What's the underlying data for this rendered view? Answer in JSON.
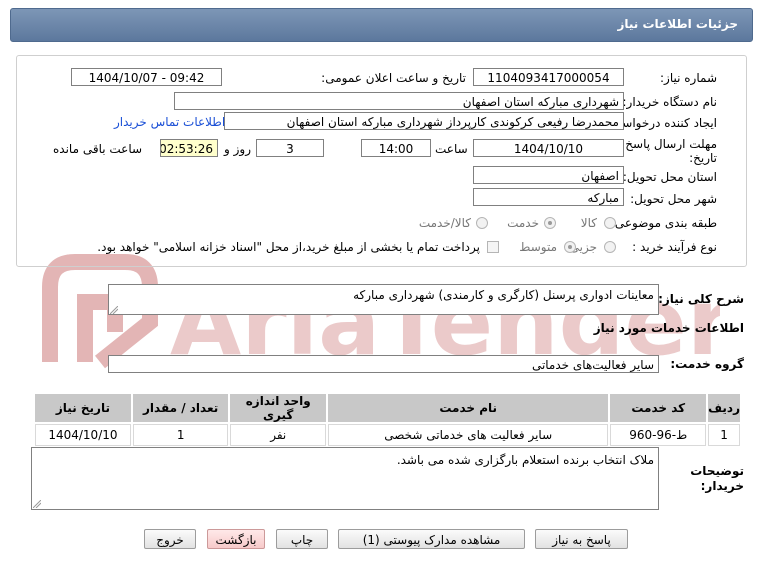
{
  "header": {
    "title": "جزئیات اطلاعات نیاز"
  },
  "fields": {
    "need_number_label": "شماره نیاز:",
    "need_number": "1104093417000054",
    "announce_label": "تاریخ و ساعت اعلان عمومی:",
    "announce_value": "1404/10/07 - 09:42",
    "buyer_org_label": "نام دستگاه خریدار:",
    "buyer_org": "شهرداری مبارکه استان اصفهان",
    "creator_label": "ایجاد کننده درخواست:",
    "creator": "محمدرضا رفیعی کرکوندی کارپرداز شهرداری مبارکه استان اصفهان",
    "contact_link": "اطلاعات تماس خریدار",
    "deadline_label_1": "مهلت ارسال پاسخ: تا",
    "deadline_label_2": "تاریخ:",
    "deadline_date": "1404/10/10",
    "time_label": "ساعت",
    "deadline_time": "14:00",
    "days_value": "3",
    "days_label": "روز و",
    "remaining_time": "02:53:26",
    "remaining_label": "ساعت باقی مانده",
    "province_label": "استان محل تحویل:",
    "province": "اصفهان",
    "city_label": "شهر محل تحویل:",
    "city": "مبارکه",
    "category_label": "طبقه بندی موضوعی:",
    "category_options": [
      "کالا",
      "خدمت",
      "کالا/خدمت"
    ],
    "category_selected": "خدمت",
    "process_label": "نوع فرآیند خرید :",
    "process_options": [
      "جزیی",
      "متوسط"
    ],
    "process_selected": "متوسط",
    "payment_note": "پرداخت تمام یا بخشی از مبلغ خرید،از محل \"اسناد خزانه اسلامی\" خواهد بود."
  },
  "description": {
    "label": "شرح کلی نیاز:",
    "value": "معاینات ادواری پرسنل (کارگری و کارمندی) شهرداری مبارکه"
  },
  "services": {
    "section_title": "اطلاعات خدمات مورد نیاز",
    "group_label": "گروه خدمت:",
    "group_value": "سایر فعالیت‌های خدماتی",
    "table": {
      "headers": [
        "ردیف",
        "کد خدمت",
        "نام خدمت",
        "واحد اندازه گیری",
        "تعداد / مقدار",
        "تاریخ نیاز"
      ],
      "rows": [
        [
          "1",
          "ط-96-960",
          "سایر فعالیت های خدماتی شخصی",
          "نفر",
          "1",
          "1404/10/10"
        ]
      ]
    }
  },
  "buyer_notes": {
    "label_1": "توضیحات",
    "label_2": "خریدار:",
    "value": "ملاک انتخاب برنده استعلام بارگزاری شده می باشد."
  },
  "buttons": {
    "reply": "پاسخ به نیاز",
    "attachments": "مشاهده مدارک پیوستی (1)",
    "print": "چاپ",
    "back": "بازگشت",
    "exit": "خروج"
  },
  "watermark": {
    "text": "AriaTender.net"
  },
  "colors": {
    "header": "#6a84a8",
    "link": "#1a4fd6",
    "highlight": "#ffffcc",
    "watermark": "#d8a0a0"
  }
}
